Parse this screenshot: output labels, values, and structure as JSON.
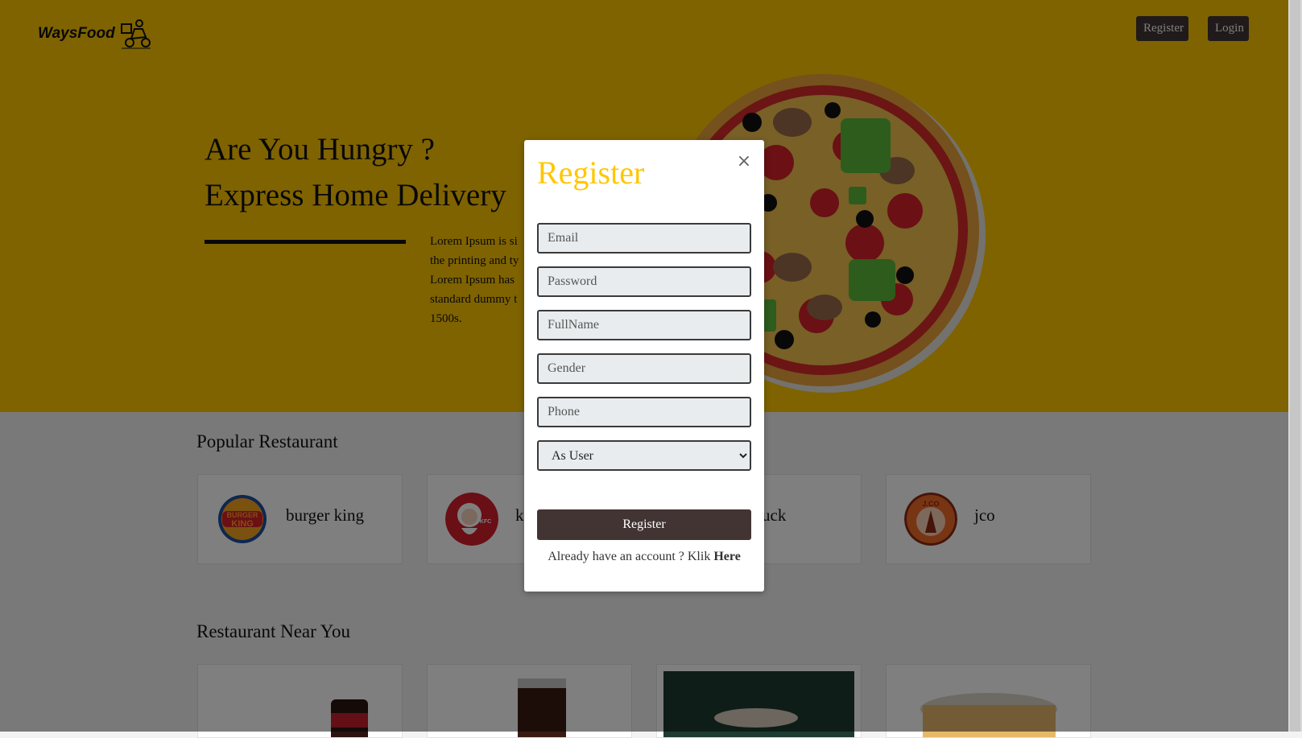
{
  "header": {
    "logo_text": "WaysFood",
    "register_label": "Register",
    "login_label": "Login"
  },
  "hero": {
    "title_line1": "Are You Hungry ?",
    "title_line2": "Express Home Delivery",
    "desc_line1": "Lorem Ipsum is si",
    "desc_line2": "the printing and ty",
    "desc_line3": "Lorem Ipsum has",
    "desc_line4": "standard dummy t",
    "desc_line5": "1500s."
  },
  "popular": {
    "title": "Popular Restaurant",
    "items": [
      {
        "name": "burger king",
        "icon": "burger-king-logo"
      },
      {
        "name": "k",
        "icon": "kfc-logo"
      },
      {
        "name": "rBuck",
        "icon": "starbucks-logo"
      },
      {
        "name": "jco",
        "icon": "jco-logo"
      }
    ]
  },
  "near": {
    "title": "Restaurant Near You"
  },
  "modal": {
    "title": "Register",
    "close": "×",
    "email_placeholder": "Email",
    "password_placeholder": "Password",
    "fullname_placeholder": "FullName",
    "gender_placeholder": "Gender",
    "phone_placeholder": "Phone",
    "role_selected": "As User",
    "submit_label": "Register",
    "switch_prefix": "Already have an account ? Klik ",
    "switch_link": "Here"
  },
  "colors": {
    "brand_yellow": "#ffc700",
    "button_dark": "#433434"
  }
}
